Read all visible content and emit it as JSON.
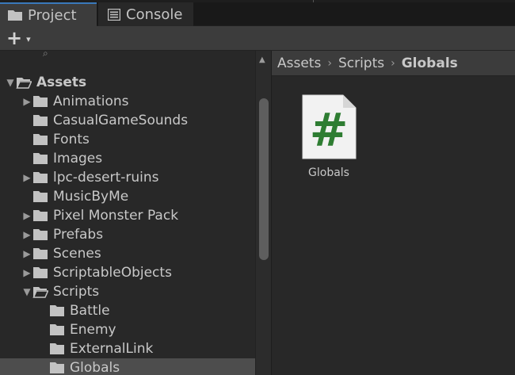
{
  "tabs": [
    {
      "label": "Project",
      "icon": "folder-icon",
      "active": true
    },
    {
      "label": "Console",
      "icon": "console-icon",
      "active": false
    }
  ],
  "toolbar": {
    "add_label": "+",
    "add_caret": "▾"
  },
  "tree": {
    "root": {
      "label": "Assets",
      "expanded": true
    },
    "items": [
      {
        "label": "Animations",
        "has_children": true,
        "expanded": false
      },
      {
        "label": "CasualGameSounds",
        "has_children": false
      },
      {
        "label": "Fonts",
        "has_children": false
      },
      {
        "label": "Images",
        "has_children": false
      },
      {
        "label": "lpc-desert-ruins",
        "has_children": true,
        "expanded": false
      },
      {
        "label": "MusicByMe",
        "has_children": false
      },
      {
        "label": "Pixel Monster Pack",
        "has_children": true,
        "expanded": false
      },
      {
        "label": "Prefabs",
        "has_children": true,
        "expanded": false
      },
      {
        "label": "Scenes",
        "has_children": true,
        "expanded": false
      },
      {
        "label": "ScriptableObjects",
        "has_children": true,
        "expanded": false
      },
      {
        "label": "Scripts",
        "has_children": true,
        "expanded": true
      },
      {
        "label": "Battle",
        "has_children": false
      },
      {
        "label": "Enemy",
        "has_children": false
      },
      {
        "label": "ExternalLink",
        "has_children": false
      },
      {
        "label": "Globals",
        "has_children": false,
        "selected": true
      }
    ]
  },
  "breadcrumb": {
    "items": [
      "Assets",
      "Scripts"
    ],
    "current": "Globals",
    "separator": "›"
  },
  "assets": [
    {
      "name": "Globals",
      "type": "csharp-script",
      "glyph": "#"
    }
  ],
  "colors": {
    "accent": "#3a79bb",
    "panel": "#282828",
    "toolbar": "#3c3c3c",
    "selected_row": "#4d4d4d",
    "script_hash": "#2e7d32",
    "folder": "#c2c2c2"
  }
}
